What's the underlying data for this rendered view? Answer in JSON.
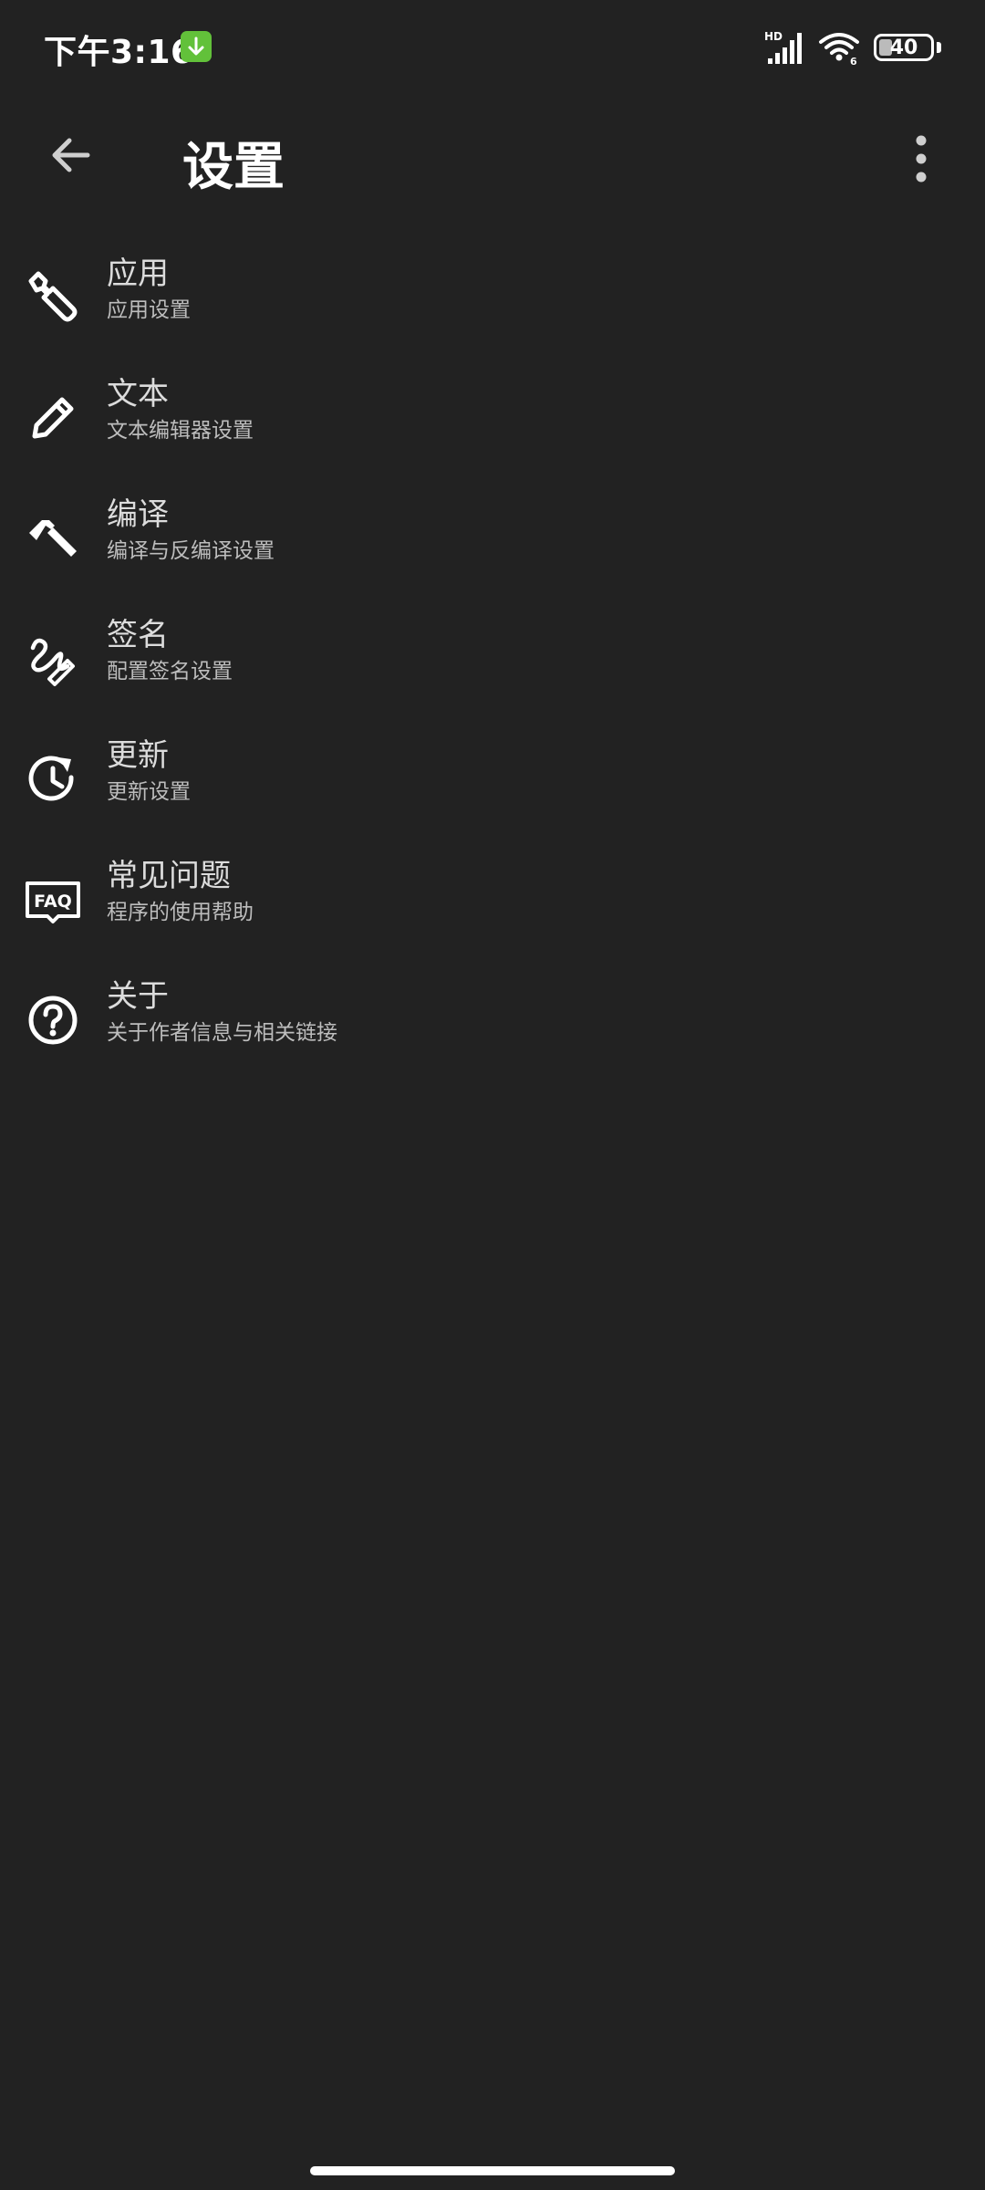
{
  "status_bar": {
    "time": "下午3:16",
    "network_label": "HD",
    "wifi_label": "6",
    "battery_level": "40",
    "notification_icon": "download-icon"
  },
  "app_bar": {
    "title": "设置",
    "back_icon": "arrow-back-icon",
    "more_icon": "more-vert-icon"
  },
  "settings": {
    "items": [
      {
        "title": "应用",
        "subtitle": "应用设置",
        "icon": "wrench-icon"
      },
      {
        "title": "文本",
        "subtitle": "文本编辑器设置",
        "icon": "pencil-icon"
      },
      {
        "title": "编译",
        "subtitle": "编译与反编译设置",
        "icon": "hammer-icon"
      },
      {
        "title": "签名",
        "subtitle": "配置签名设置",
        "icon": "signature-icon"
      },
      {
        "title": "更新",
        "subtitle": "更新设置",
        "icon": "update-icon"
      },
      {
        "title": "常见问题",
        "subtitle": "程序的使用帮助",
        "icon": "faq-icon"
      },
      {
        "title": "关于",
        "subtitle": "关于作者信息与相关链接",
        "icon": "help-circle-icon"
      }
    ]
  },
  "colors": {
    "background": "#222222",
    "title_text": "#dcdcdc",
    "subtitle_text": "#bdbdbd",
    "notification_green": "#62c13a"
  }
}
